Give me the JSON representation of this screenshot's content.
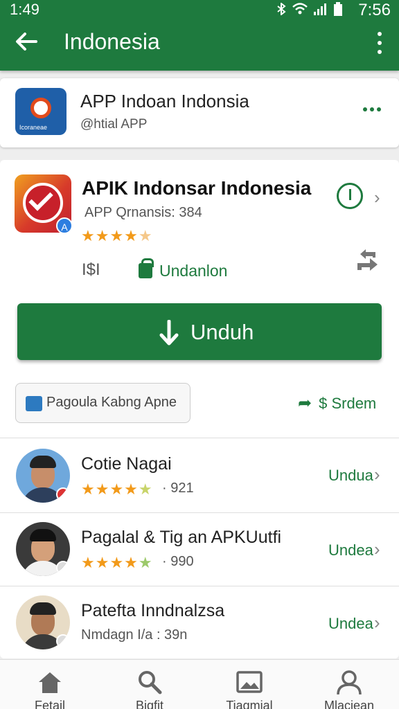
{
  "status_bar": {
    "time_left": "1:49",
    "time_right": "7:56"
  },
  "app_bar": {
    "title": "Indonesia"
  },
  "featured": {
    "title": "APP Indoan Indonsia",
    "subtitle": "@htial APP",
    "icon_label": "Icoraneae"
  },
  "app": {
    "title": "APIK Indonsar Indonesia",
    "subtitle": "APP Qrnansis: 384",
    "rating": 4.5,
    "price": "I$I",
    "store_label": "Undanlon",
    "download_label": "Unduh",
    "chip_label": "Pagoula Kabng Apne",
    "send_label": "$ Srdem",
    "badge_letter": "A"
  },
  "list": [
    {
      "title": "Cotie Nagai",
      "rating": 4.5,
      "meta": "· 921",
      "action": "Undua"
    },
    {
      "title": "Pagalal & Tig an APKUutfi",
      "rating": 4.5,
      "meta": "· 990",
      "action": "Undea"
    },
    {
      "title": "Patefta Inndnalzsa",
      "meta": "Nmdagn I/a : 39n",
      "action": "Undea"
    }
  ],
  "nav": [
    {
      "label": "Fetail",
      "icon": "home-icon"
    },
    {
      "label": "Bigfit",
      "icon": "search-icon"
    },
    {
      "label": "Tiagmial",
      "icon": "image-icon"
    },
    {
      "label": "Mlaciean",
      "icon": "person-icon"
    }
  ],
  "colors": {
    "primary": "#1e7a3e",
    "star": "#f29a1a"
  }
}
